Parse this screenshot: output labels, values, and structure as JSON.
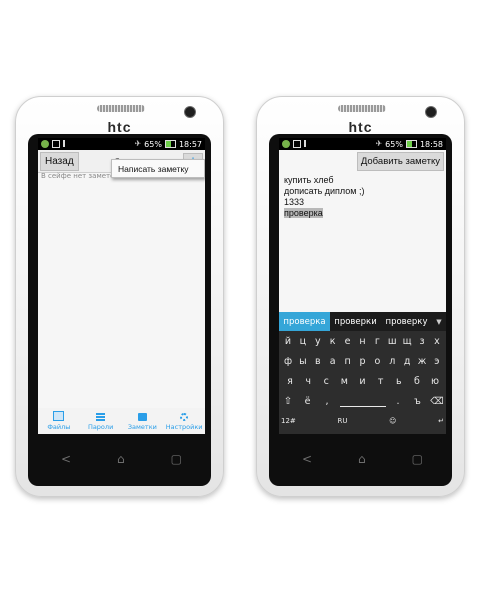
{
  "brand": "htc",
  "left_phone": {
    "status": {
      "battery": "65%",
      "time": "18:57"
    },
    "header": {
      "back_label": "Назад",
      "title": "Заметки",
      "add_label": "+"
    },
    "empty_text": "В сейфе нет заметок",
    "menu": {
      "item": "Написать заметку"
    },
    "tabs": [
      {
        "label": "Файлы",
        "icon": "file-icon"
      },
      {
        "label": "Пароли",
        "icon": "list-icon"
      },
      {
        "label": "Заметки",
        "icon": "book-icon"
      },
      {
        "label": "Настройки",
        "icon": "gear-icon"
      }
    ]
  },
  "right_phone": {
    "status": {
      "battery": "65%",
      "time": "18:58"
    },
    "header": {
      "add_note_label": "Добавить заметку"
    },
    "note_lines": [
      "купить хлеб",
      "дописать диплом ;)",
      "1333",
      "проверка"
    ],
    "suggestions": [
      "проверка",
      "проверки",
      "проверку"
    ],
    "keyboard": {
      "row1": [
        "й",
        "ц",
        "у",
        "к",
        "е",
        "н",
        "г",
        "ш",
        "щ",
        "з",
        "х"
      ],
      "row2": [
        "ф",
        "ы",
        "в",
        "а",
        "п",
        "р",
        "о",
        "л",
        "д",
        "ж",
        "э"
      ],
      "row3": [
        "я",
        "ч",
        "с",
        "м",
        "и",
        "т",
        "ь",
        "б",
        "ю"
      ],
      "row4": [
        "ё",
        "ъ"
      ],
      "bottom": {
        "numbers": "12#",
        "lang": "RU"
      }
    }
  },
  "softkeys": {
    "back": "<",
    "home": "⌂",
    "recent": "▢"
  }
}
